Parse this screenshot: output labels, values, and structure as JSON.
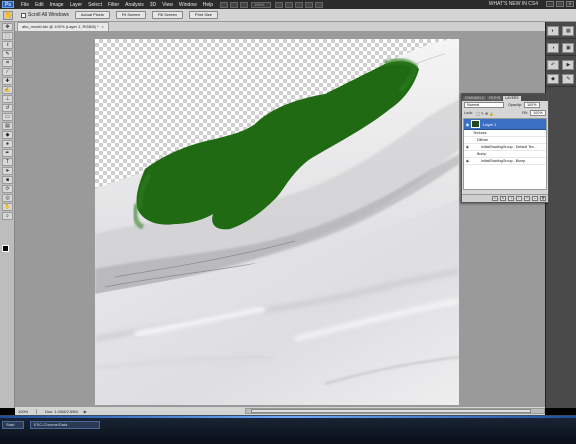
{
  "app": {
    "logo": "Ps",
    "menus": [
      "File",
      "Edit",
      "Image",
      "Layer",
      "Select",
      "Filter",
      "Analysis",
      "3D",
      "View",
      "Window",
      "Help"
    ],
    "zoom_select": "100%",
    "whats_new": "WHAT'S NEW IN CS4",
    "window_buttons": [
      "–",
      "□",
      "✕"
    ]
  },
  "options_bar": {
    "scroll_all_windows": "Scroll All Windows",
    "buttons": [
      "Actual Pixels",
      "Fit Screen",
      "Fill Screen",
      "Print Size"
    ]
  },
  "document": {
    "tab_title": "abc_model.tdx @ 100% (Layer 1, RGB/8) *",
    "tab_close": "×"
  },
  "status_bar": {
    "zoom": "100%",
    "doc_info": "Doc: 1.00M/2.59M",
    "arrow": "▶"
  },
  "taskbar": {
    "items": [
      "Start",
      "ESC-Chrome/Data"
    ]
  },
  "layers_panel": {
    "tabs": [
      "CHANNELS",
      "PATHS",
      "LAYERS"
    ],
    "active_tab": "LAYERS",
    "blend_mode": "Normal",
    "opacity_label": "Opacity:",
    "opacity_value": "100%",
    "lock_label": "Lock:",
    "fill_label": "Fill:",
    "fill_value": "100%",
    "layer_name": "Layer 1",
    "sub_items": [
      {
        "label": "Textures",
        "indent": 0
      },
      {
        "label": "Diffuse",
        "indent": 1
      },
      {
        "label": "InitialShadingGroup - Default Tex...",
        "indent": 2
      },
      {
        "label": "Bump",
        "indent": 1
      },
      {
        "label": "InitialShadingGroup - Bump",
        "indent": 2
      }
    ]
  },
  "colors": {
    "paint_green": "#1f6a12",
    "surface": "#e6e6e6",
    "selection_blue": "#3b6fc4"
  }
}
